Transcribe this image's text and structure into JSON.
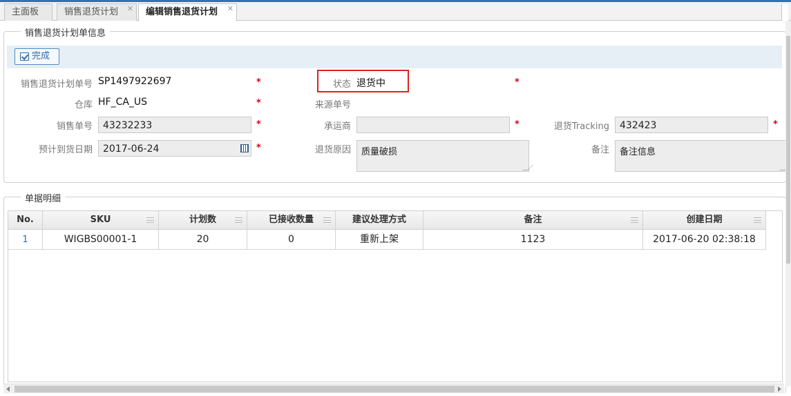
{
  "tabs": [
    {
      "label": "主面板",
      "closable": false
    },
    {
      "label": "销售退货计划",
      "closable": true
    },
    {
      "label": "编辑销售退货计划",
      "closable": true,
      "active": true
    }
  ],
  "info_panel": {
    "legend": "销售退货计划单信息",
    "done_button": "完成",
    "fields": {
      "plan_no": {
        "label": "销售退货计划单号",
        "value": "SP1497922697"
      },
      "status": {
        "label": "状态",
        "value": "退货中"
      },
      "warehouse": {
        "label": "仓库",
        "value": "HF_CA_US"
      },
      "source_no": {
        "label": "来源单号",
        "value": ""
      },
      "sales_no": {
        "label": "销售单号",
        "value": "43232233"
      },
      "carrier": {
        "label": "承运商",
        "value": ""
      },
      "tracking": {
        "label": "退货Tracking",
        "value": "432423"
      },
      "eta": {
        "label": "预计到货日期",
        "value": "2017-06-24"
      },
      "reason": {
        "label": "退货原因",
        "value": "质量破损"
      },
      "remark": {
        "label": "备注",
        "value": "备注信息"
      }
    },
    "required_mark": "*"
  },
  "detail_panel": {
    "legend": "单据明细",
    "columns": [
      "No.",
      "SKU",
      "计划数",
      "已接收数量",
      "建议处理方式",
      "备注",
      "创建日期"
    ],
    "rows": [
      [
        "1",
        "WIGBS00001-1",
        "20",
        "0",
        "重新上架",
        "1123",
        "2017-06-20 02:38:18"
      ]
    ]
  },
  "colors": {
    "accent": "#2d73b8",
    "required": "#d0021b",
    "highlight": "#e02020"
  }
}
